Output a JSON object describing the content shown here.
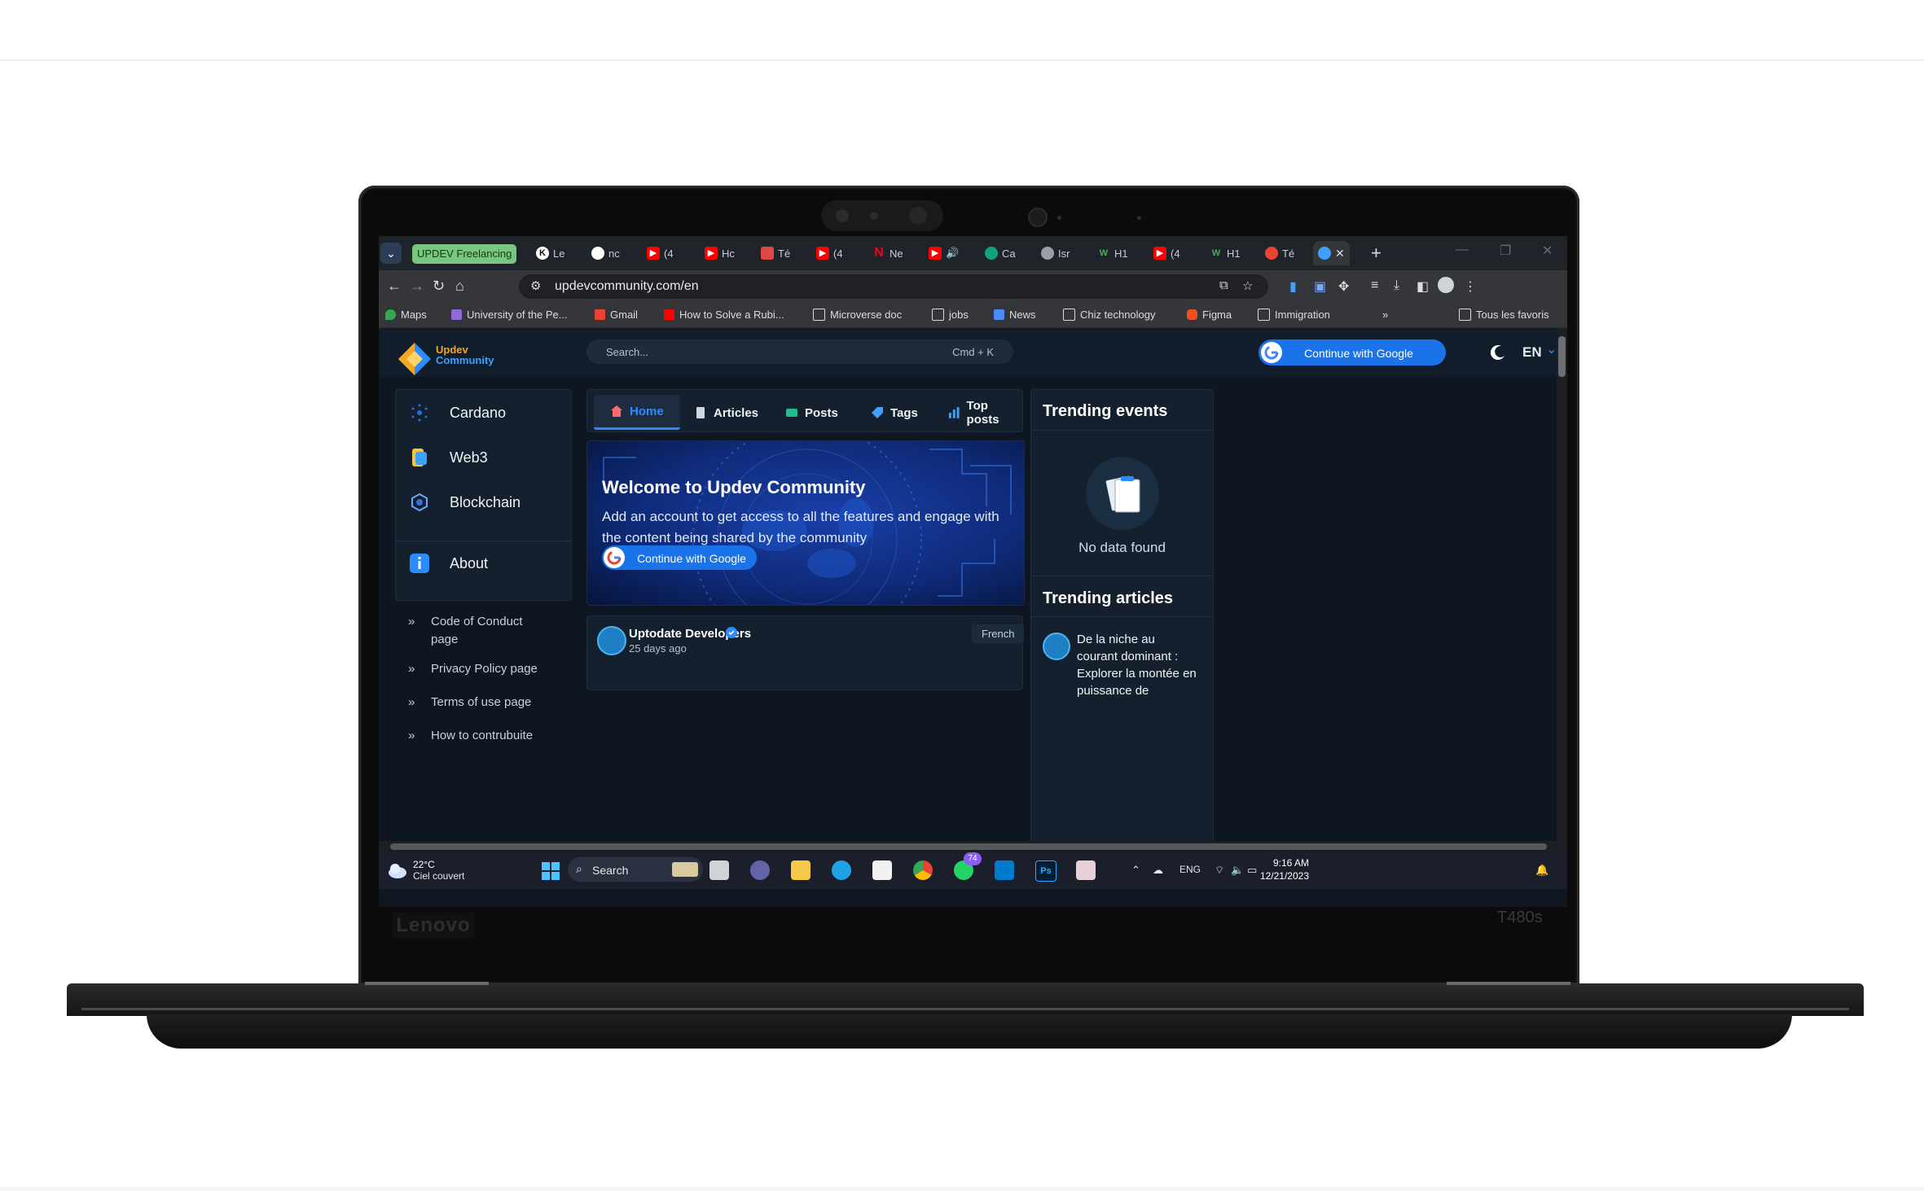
{
  "browser": {
    "tab_group_label": "UPDEV Freelancing",
    "tabs": [
      {
        "title": "Le",
        "icon": "tab-icon-letter"
      },
      {
        "title": "nc",
        "icon": "github-icon"
      },
      {
        "title": "(4",
        "icon": "youtube-icon"
      },
      {
        "title": "Hc",
        "icon": "youtube-icon"
      },
      {
        "title": "Té",
        "icon": "gmail-like-icon"
      },
      {
        "title": "(4",
        "icon": "youtube-icon"
      },
      {
        "title": "Ne",
        "icon": "netflix-icon"
      },
      {
        "title": "",
        "icon": "youtube-icon"
      },
      {
        "title": "Ca",
        "icon": "chatgpt-icon"
      },
      {
        "title": "Isr",
        "icon": "globe-icon"
      },
      {
        "title": "H1",
        "icon": "w-icon"
      },
      {
        "title": "(4",
        "icon": "youtube-icon"
      },
      {
        "title": "H1",
        "icon": "w-icon"
      },
      {
        "title": "Té",
        "icon": "red-app-icon"
      }
    ],
    "url": "updevcommunity.com/en",
    "bookmarks": [
      {
        "label": "Maps",
        "icon": "maps-icon"
      },
      {
        "label": "University of the Pe...",
        "icon": "university-icon"
      },
      {
        "label": "Gmail",
        "icon": "gmail-icon"
      },
      {
        "label": "How to Solve a Rubi...",
        "icon": "youtube-icon"
      },
      {
        "label": "Microverse doc",
        "icon": "folder-icon"
      },
      {
        "label": "jobs",
        "icon": "folder-icon"
      },
      {
        "label": "News",
        "icon": "news-icon"
      },
      {
        "label": "Chiz technology",
        "icon": "folder-icon"
      },
      {
        "label": "Figma",
        "icon": "figma-icon"
      },
      {
        "label": "Immigration",
        "icon": "folder-icon"
      }
    ],
    "all_bookmarks_label": "Tous les favoris"
  },
  "site": {
    "logo_line1": "Updev",
    "logo_line2": "Community",
    "search_placeholder": "Search...",
    "search_shortcut": "Cmd + K",
    "google_button": "Continue with Google",
    "language": "EN",
    "sidebar": [
      {
        "label": "Cardano"
      },
      {
        "label": "Web3"
      },
      {
        "label": "Blockchain"
      },
      {
        "label": "About"
      }
    ],
    "footer_links": [
      "Code of Conduct page",
      "Privacy Policy page",
      "Terms of use page",
      "How to contrubuite"
    ],
    "nav_tabs": [
      {
        "label": "Home"
      },
      {
        "label": "Articles"
      },
      {
        "label": "Posts"
      },
      {
        "label": "Tags"
      },
      {
        "label": "Top posts"
      }
    ],
    "hero": {
      "title": "Welcome to Updev Community",
      "text": "Add an account to get access to all the features and engage with the content being shared by the community",
      "button": "Continue with Google"
    },
    "post": {
      "author": "Uptodate Developers",
      "date": "25 days ago",
      "language": "French"
    },
    "trending_events_title": "Trending events",
    "no_data": "No data found",
    "trending_articles_title": "Trending articles",
    "trending_article": "De la niche au courant dominant : Explorer la montée en puissance de"
  },
  "taskbar": {
    "temperature": "22°C",
    "weather": "Ciel couvert",
    "search_label": "Search",
    "whatsapp_badge": "74",
    "language": "ENG",
    "time": "9:16 AM",
    "date": "12/21/2023"
  },
  "device": {
    "brand": "Lenovo",
    "model": "T480s"
  },
  "colors": {
    "accent": "#1a73e8",
    "page_bg": "#0d1621",
    "card_bg": "#14202d",
    "link_blue": "#2b8cff"
  }
}
